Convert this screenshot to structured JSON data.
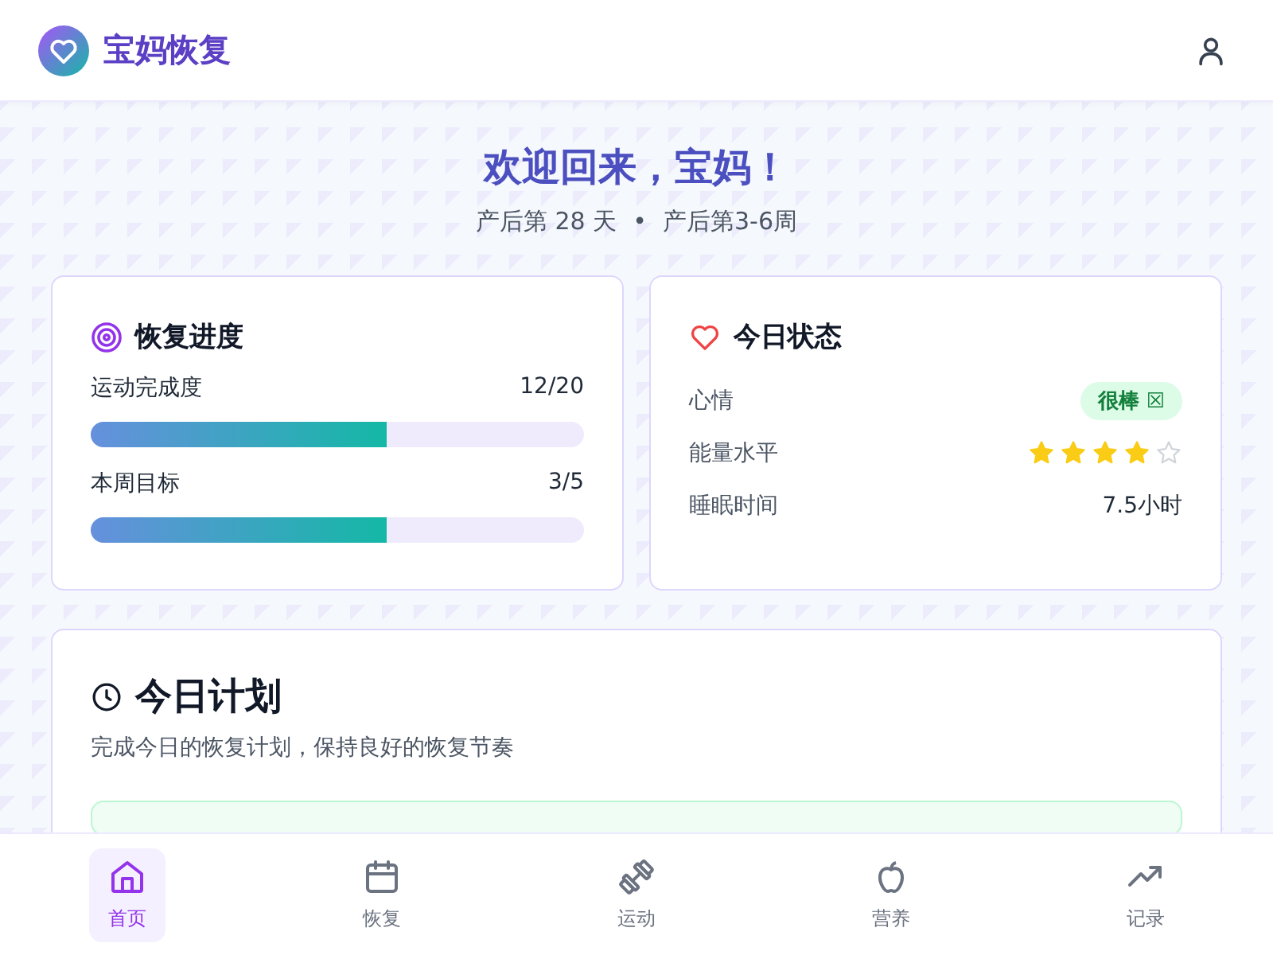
{
  "header": {
    "app_name": "宝妈恢复"
  },
  "welcome": {
    "title": "欢迎回来，宝妈！",
    "day": "产后第 28 天",
    "separator": "•",
    "stage": "产后第3-6周"
  },
  "progress_card": {
    "title": "恢复进度",
    "items": [
      {
        "label": "运动完成度",
        "value": "12/20",
        "level": 0.6
      },
      {
        "label": "本周目标",
        "value": "3/5",
        "level": 0.6
      }
    ]
  },
  "status_card": {
    "title": "今日状态",
    "rows": [
      {
        "kind": "badge",
        "label": "心情",
        "value": "很棒 ☒"
      },
      {
        "kind": "stars",
        "label": "能量水平",
        "stars": 4
      },
      {
        "kind": "text",
        "label": "睡眠时间",
        "value": "7.5小时"
      }
    ]
  },
  "plan": {
    "title": "今日计划",
    "subtitle": "完成今日的恢复计划，保持良好的恢复节奏"
  },
  "bottom_nav": [
    {
      "label": "首页",
      "selected": true
    },
    {
      "label": "恢复",
      "selected": false
    },
    {
      "label": "运动",
      "selected": false
    },
    {
      "label": "营养",
      "selected": false
    },
    {
      "label": "记录",
      "selected": false
    }
  ]
}
